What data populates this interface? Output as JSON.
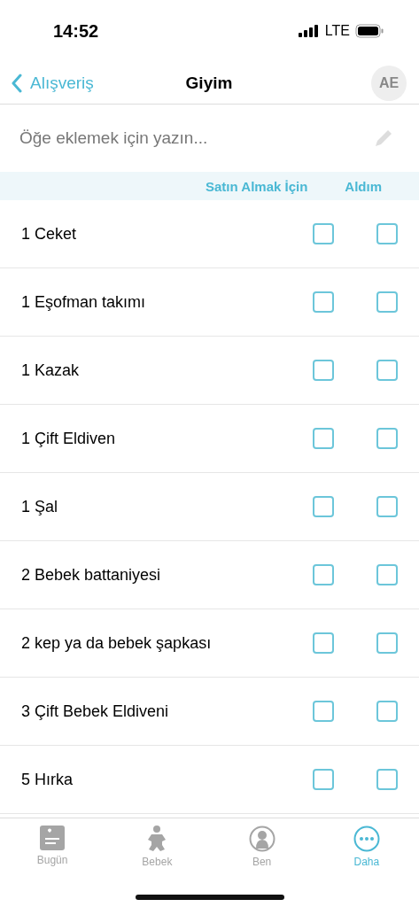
{
  "status_bar": {
    "time": "14:52",
    "network": "LTE"
  },
  "nav": {
    "back": "Alışveriş",
    "title": "Giyim",
    "avatar": "AE"
  },
  "add_field": {
    "placeholder": "Öğe eklemek için yazın..."
  },
  "columns": [
    "Satın Almak İçin",
    "Aldım"
  ],
  "items": [
    {
      "name": "1 Ceket",
      "to_buy": false,
      "bought": false
    },
    {
      "name": "1 Eşofman takımı",
      "to_buy": false,
      "bought": false
    },
    {
      "name": "1 Kazak",
      "to_buy": false,
      "bought": false
    },
    {
      "name": "1 Çift Eldiven",
      "to_buy": false,
      "bought": false
    },
    {
      "name": "1 Şal",
      "to_buy": false,
      "bought": false
    },
    {
      "name": "2 Bebek battaniyesi",
      "to_buy": false,
      "bought": false
    },
    {
      "name": "2 kep ya da bebek şapkası",
      "to_buy": false,
      "bought": false
    },
    {
      "name": "3 Çift Bebek Eldiveni",
      "to_buy": false,
      "bought": false
    },
    {
      "name": "5 Hırka",
      "to_buy": false,
      "bought": false
    }
  ],
  "tabs": [
    {
      "label": "Bugün",
      "kind": "today",
      "selected": false
    },
    {
      "label": "Bebek",
      "kind": "baby",
      "selected": false
    },
    {
      "label": "Ben",
      "kind": "me",
      "selected": false
    },
    {
      "label": "Daha",
      "kind": "more",
      "selected": true
    }
  ]
}
